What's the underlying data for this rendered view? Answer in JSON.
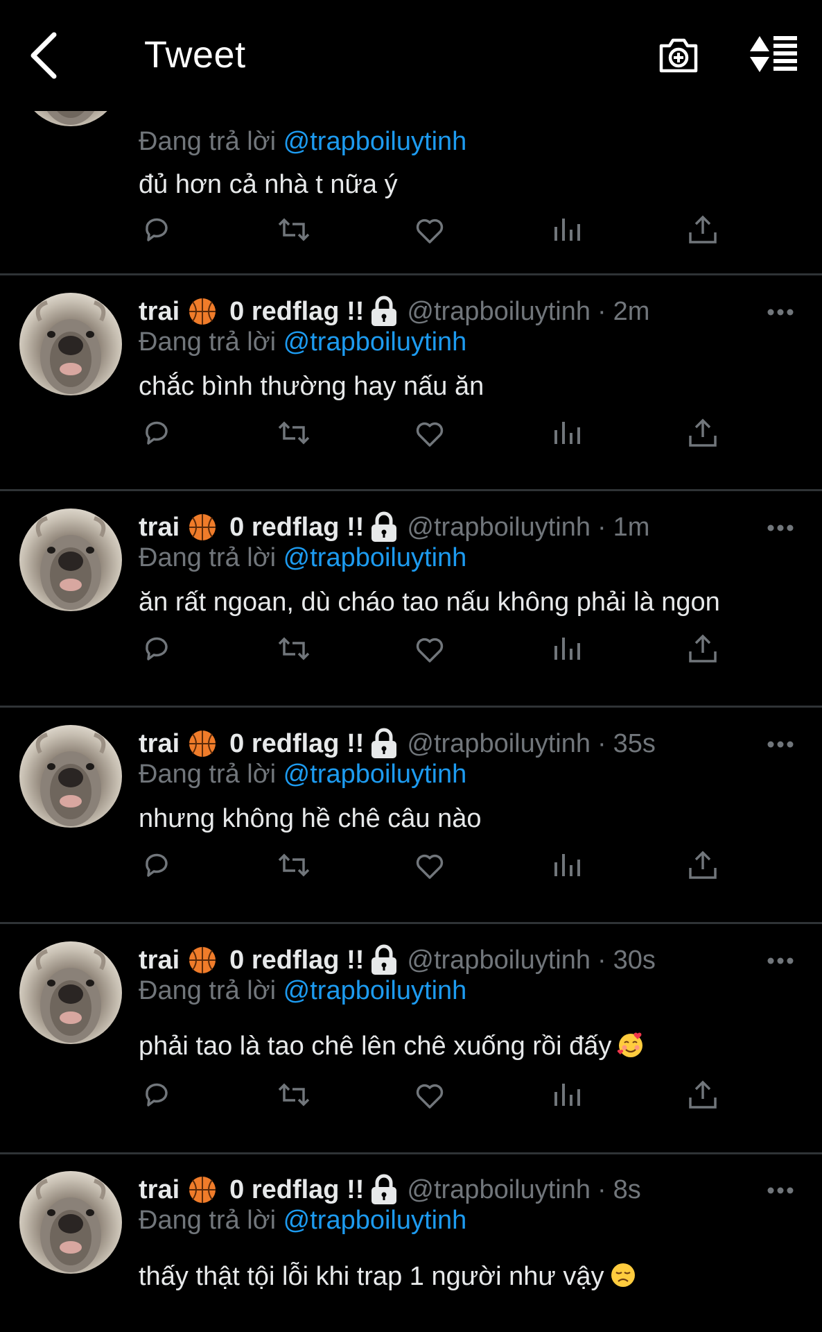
{
  "header": {
    "title": "Tweet",
    "icons": [
      "back-chevron-icon",
      "camera-plus-icon",
      "sort-list-icon"
    ]
  },
  "author": {
    "display_name_part1": "trai",
    "display_name_part2": "0 redflag !!",
    "handle": "@trapboiluytinh",
    "emoji_name": "basketball-emoji",
    "protected_icon": "lock-icon"
  },
  "reply_prefix": "Đang trả lời",
  "reply_handle": "@trapboiluytinh",
  "tweets": [
    {
      "time": "",
      "text": "đủ hơn cả nhà t nữa ý"
    },
    {
      "time": "2m",
      "text": "chắc bình thường hay nấu ăn"
    },
    {
      "time": "1m",
      "text": "ăn rất ngoan, dù cháo tao nấu không phải là ngon"
    },
    {
      "time": "35s",
      "text": "nhưng không hề chê câu nào"
    },
    {
      "time": "30s",
      "text": "phải tao là tao chê lên chê xuống rồi đấy",
      "emoji": "smiling-face-with-hearts"
    },
    {
      "time": "8s",
      "text": "thấy thật tội lỗi khi trap 1 người như vậy",
      "emoji": "disappointed-face"
    }
  ],
  "action_icons": [
    "reply-icon",
    "retweet-icon",
    "like-icon",
    "views-icon",
    "share-icon"
  ],
  "colors": {
    "background": "#000000",
    "text": "#e7e9ea",
    "secondary": "#71767b",
    "link": "#1d9bf0",
    "divider": "#2f3336"
  }
}
